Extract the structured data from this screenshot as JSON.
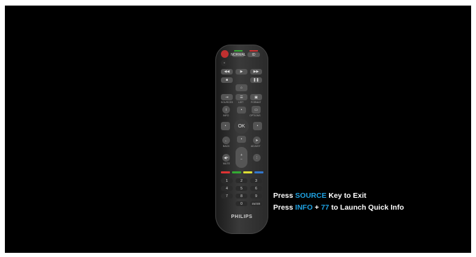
{
  "colors": {
    "accent": "#1ea0e0",
    "background": "#000000",
    "text": "#ffffff"
  },
  "remote": {
    "brand": "PHILIPS",
    "top_buttons": [
      "NORMAL",
      "ID"
    ],
    "labels": {
      "sources": "SOURCES",
      "list": "LIST",
      "format": "FORMAT",
      "info": "INFO",
      "options": "OPTIONS",
      "ok": "OK",
      "back": "BACK",
      "adjust": "ADJUST",
      "mute": "MUTE"
    },
    "numpad": [
      "1",
      "2",
      "3",
      "4",
      "5",
      "6",
      "7",
      "8",
      "9",
      "0",
      "ENTER"
    ],
    "color_keys": [
      "#d33",
      "#3a3",
      "#dd3",
      "#37c"
    ]
  },
  "instructions": {
    "line1": {
      "pre": "Press ",
      "key": "SOURCE",
      "post": " Key to Exit"
    },
    "line2": {
      "pre": "Press ",
      "key": "INFO",
      "mid": " + ",
      "num": "77",
      "post": " to Launch Quick Info"
    }
  }
}
